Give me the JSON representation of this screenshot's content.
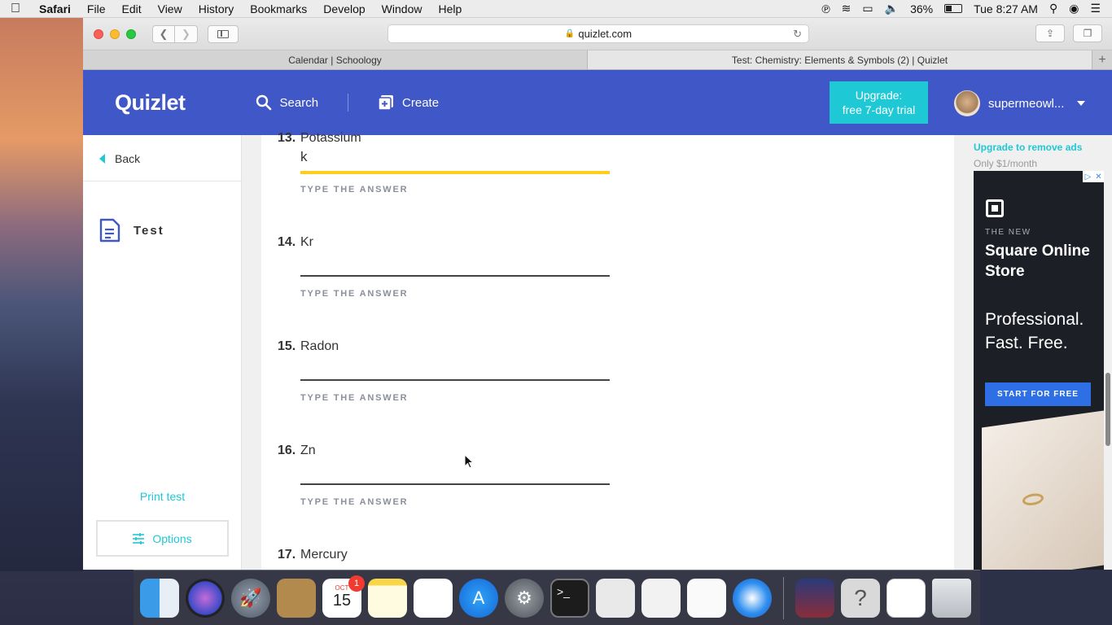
{
  "menubar": {
    "app": "Safari",
    "items": [
      "File",
      "Edit",
      "View",
      "History",
      "Bookmarks",
      "Develop",
      "Window",
      "Help"
    ],
    "battery_percent": "36%",
    "clock": "Tue 8:27 AM"
  },
  "browser": {
    "url": "quizlet.com",
    "tabs": [
      {
        "title": "Calendar | Schoology"
      },
      {
        "title": "Test: Chemistry: Elements & Symbols (2) | Quizlet"
      }
    ]
  },
  "header": {
    "logo": "Quizlet",
    "search_label": "Search",
    "create_label": "Create",
    "upgrade_line1": "Upgrade:",
    "upgrade_line2": "free 7-day trial",
    "username": "supermeowl..."
  },
  "sidebar": {
    "back_label": "Back",
    "mode_label": "Test",
    "print_label": "Print test",
    "options_label": "Options"
  },
  "questions": [
    {
      "number": "13.",
      "term": "Potassium",
      "answer": "k",
      "hint": "TYPE THE ANSWER"
    },
    {
      "number": "14.",
      "term": "Kr",
      "answer": "",
      "hint": "TYPE THE ANSWER"
    },
    {
      "number": "15.",
      "term": "Radon",
      "answer": "",
      "hint": "TYPE THE ANSWER"
    },
    {
      "number": "16.",
      "term": "Zn",
      "answer": "",
      "hint": "TYPE THE ANSWER"
    },
    {
      "number": "17.",
      "term": "Mercury",
      "answer": "",
      "hint": ""
    }
  ],
  "ad": {
    "upgrade_link": "Upgrade to remove ads",
    "price": "Only $1/month",
    "eyebrow": "THE NEW",
    "title": "Square Online Store",
    "tagline": "Professional. Fast. Free.",
    "cta": "START FOR FREE"
  },
  "dock": {
    "calendar_month": "OCT",
    "calendar_day": "15",
    "calendar_badge": "1"
  },
  "colors": {
    "quizlet_blue": "#4057c8",
    "accent_teal": "#1ec8d4",
    "active_underline": "#ffcd1f"
  }
}
